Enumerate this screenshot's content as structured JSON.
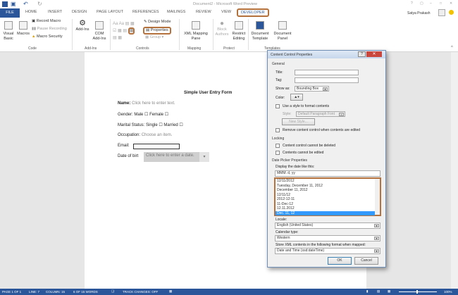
{
  "window": {
    "title": "Document2 - Microsoft Word Preview",
    "user": "Satya Prakash",
    "controls": [
      "?",
      "▢",
      "–",
      "□",
      "✕"
    ]
  },
  "tabs": [
    "FILE",
    "HOME",
    "INSERT",
    "DESIGN",
    "PAGE LAYOUT",
    "REFERENCES",
    "MAILINGS",
    "REVIEW",
    "VIEW",
    "DEVELOPER"
  ],
  "ribbon": {
    "code": {
      "label": "Code",
      "visual_basic": "Visual Basic",
      "macros": "Macros",
      "record": "Record Macro",
      "pause": "Pause Recording",
      "security": "Macro Security"
    },
    "addins": {
      "label": "Add-Ins",
      "addins": "Add-Ins",
      "com": "COM Add-Ins"
    },
    "controls": {
      "label": "Controls",
      "design_mode": "Design Mode",
      "properties": "Properties",
      "group": "Group"
    },
    "mapping": {
      "label": "Mapping",
      "xml": "XML Mapping Pane"
    },
    "protect": {
      "label": "Protect",
      "block": "Block Authors",
      "restrict": "Restrict Editing"
    },
    "templates": {
      "label": "Templates",
      "doc_template": "Document Template",
      "doc_panel": "Document Panel"
    }
  },
  "document": {
    "title": "Simple User Entry Form",
    "name_label": "Name:",
    "name_ph": "Click here to enter text.",
    "gender": "Gender: Male ☐ Female ☐",
    "marital": "Marital Status:  Single ☐ Married ☐",
    "occupation_label": "Occupation:",
    "occupation_ph": "Choose an item.",
    "email_label": "Email:",
    "dob_label": "Date of birt",
    "dob_ph": "Click here to enter a date."
  },
  "dialog": {
    "title": "Content Control Properties",
    "general": "General",
    "title_label": "Title:",
    "tag_label": "Tag:",
    "show_as_label": "Show as:",
    "show_as_value": "Bounding Box",
    "color_label": "Color:",
    "use_style": "Use a style to format contents",
    "style_label": "Style:",
    "style_value": "Default Paragraph Font",
    "new_style": "New Style...",
    "remove": "Remove content control when contents are edited",
    "locking": "Locking",
    "lock_delete": "Content control cannot be deleted",
    "lock_edit": "Contents cannot be edited",
    "date_picker": "Date Picker Properties",
    "display_label": "Display the date like this:",
    "format_value": "MMM. d, yy",
    "formats": [
      "12/11/2012",
      "Tuesday, December 11, 2012",
      "December 11, 2012",
      "12/11/12",
      "2012-12-11",
      "11-Dec-12",
      "12.11.2012",
      "Dec. 11, 12"
    ],
    "selected_format": 7,
    "locale_label": "Locale:",
    "locale_value": "English (United States)",
    "calendar_label": "Calendar type:",
    "calendar_value": "Western",
    "store_label": "Store XML contents in the following format when mapped:",
    "store_value": "Date and Time (xsd:dateTime)",
    "ok": "OK",
    "cancel": "Cancel"
  },
  "status": {
    "page": "PAGE 1 OF 1",
    "line": "LINE: 7",
    "column": "COLUMN: 15",
    "words": "6 OF 15 WORDS",
    "track": "TRACK CHANGES: OFF",
    "zoom": "100%"
  },
  "colors": {
    "accent": "#2b579a",
    "highlight": "#b5713c",
    "selection": "#3399ff"
  }
}
